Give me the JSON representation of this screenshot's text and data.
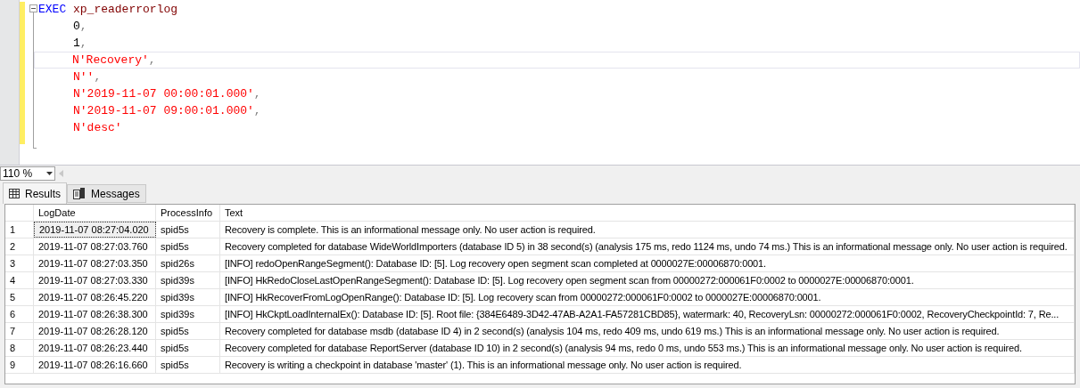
{
  "editor": {
    "lines": [
      {
        "current": false,
        "tokens": [
          {
            "kind": "keyword",
            "text": "EXEC"
          },
          {
            "kind": "sysproc",
            "text": "xp_readerrorlog"
          }
        ]
      },
      {
        "current": false,
        "tokens": [
          {
            "kind": "plain",
            "text": "0"
          },
          {
            "kind": "punct",
            "text": ","
          }
        ]
      },
      {
        "current": false,
        "tokens": [
          {
            "kind": "plain",
            "text": "1"
          },
          {
            "kind": "punct",
            "text": ","
          }
        ]
      },
      {
        "current": true,
        "tokens": [
          {
            "kind": "string",
            "text": "N'Recovery'"
          },
          {
            "kind": "punct",
            "text": ","
          }
        ]
      },
      {
        "current": false,
        "tokens": [
          {
            "kind": "string",
            "text": "N''"
          },
          {
            "kind": "punct",
            "text": ","
          }
        ]
      },
      {
        "current": false,
        "tokens": [
          {
            "kind": "string",
            "text": "N'2019-11-07 00:00:01.000'"
          },
          {
            "kind": "punct",
            "text": ","
          }
        ]
      },
      {
        "current": false,
        "tokens": [
          {
            "kind": "string",
            "text": "N'2019-11-07 09:00:01.000'"
          },
          {
            "kind": "punct",
            "text": ","
          }
        ]
      },
      {
        "current": false,
        "tokens": [
          {
            "kind": "string",
            "text": "N'desc'"
          }
        ]
      }
    ]
  },
  "zoom": {
    "value": "110 %"
  },
  "tabs": [
    {
      "label": "Results",
      "selected": true,
      "kind": "grid"
    },
    {
      "label": "Messages",
      "selected": false,
      "kind": "messages"
    }
  ],
  "table": {
    "columns": [
      "LogDate",
      "ProcessInfo",
      "Text"
    ],
    "rows": [
      {
        "number": "1",
        "focused": true,
        "cells": [
          "2019-11-07 08:27:04.020",
          "spid5s",
          "Recovery is complete. This is an informational message only. No user action is required."
        ]
      },
      {
        "number": "2",
        "focused": false,
        "cells": [
          "2019-11-07 08:27:03.760",
          "spid5s",
          "Recovery completed for database WideWorldImporters (database ID 5) in 38 second(s) (analysis 175 ms, redo 1124 ms, undo 74 ms.) This is an informational message only. No user action is required."
        ]
      },
      {
        "number": "3",
        "focused": false,
        "cells": [
          "2019-11-07 08:27:03.350",
          "spid26s",
          "[INFO] redoOpenRangeSegment(): Database ID: [5]. Log recovery open segment scan completed at 0000027E:00006870:0001."
        ]
      },
      {
        "number": "4",
        "focused": false,
        "cells": [
          "2019-11-07 08:27:03.330",
          "spid39s",
          "[INFO] HkRedoCloseLastOpenRangeSegment(): Database ID: [5]. Log recovery open segment scan from 00000272:000061F0:0002 to 0000027E:00006870:0001."
        ]
      },
      {
        "number": "5",
        "focused": false,
        "cells": [
          "2019-11-07 08:26:45.220",
          "spid39s",
          "[INFO] HkRecoverFromLogOpenRange(): Database ID: [5]. Log recovery scan from 00000272:000061F0:0002 to 0000027E:00006870:0001."
        ]
      },
      {
        "number": "6",
        "focused": false,
        "cells": [
          "2019-11-07 08:26:38.300",
          "spid39s",
          "[INFO] HkCkptLoadInternalEx(): Database ID: [5]. Root file: {384E6489-3D42-47AB-A2A1-FA57281CBD85}, watermark: 40, RecoveryLsn: 00000272:000061F0:0002, RecoveryCheckpointId: 7, Re..."
        ]
      },
      {
        "number": "7",
        "focused": false,
        "cells": [
          "2019-11-07 08:26:28.120",
          "spid5s",
          "Recovery completed for database msdb (database ID 4) in 2 second(s) (analysis 104 ms, redo 409 ms, undo 619 ms.) This is an informational message only. No user action is required."
        ]
      },
      {
        "number": "8",
        "focused": false,
        "cells": [
          "2019-11-07 08:26:23.440",
          "spid5s",
          "Recovery completed for database ReportServer (database ID 10) in 2 second(s) (analysis 94 ms, redo 0 ms, undo 553 ms.) This is an informational message only. No user action is required."
        ]
      },
      {
        "number": "9",
        "focused": false,
        "cells": [
          "2019-11-07 08:26:16.660",
          "spid5s",
          "Recovery is writing a checkpoint in database 'master' (1). This is an informational message only. No user action is required."
        ]
      }
    ]
  }
}
